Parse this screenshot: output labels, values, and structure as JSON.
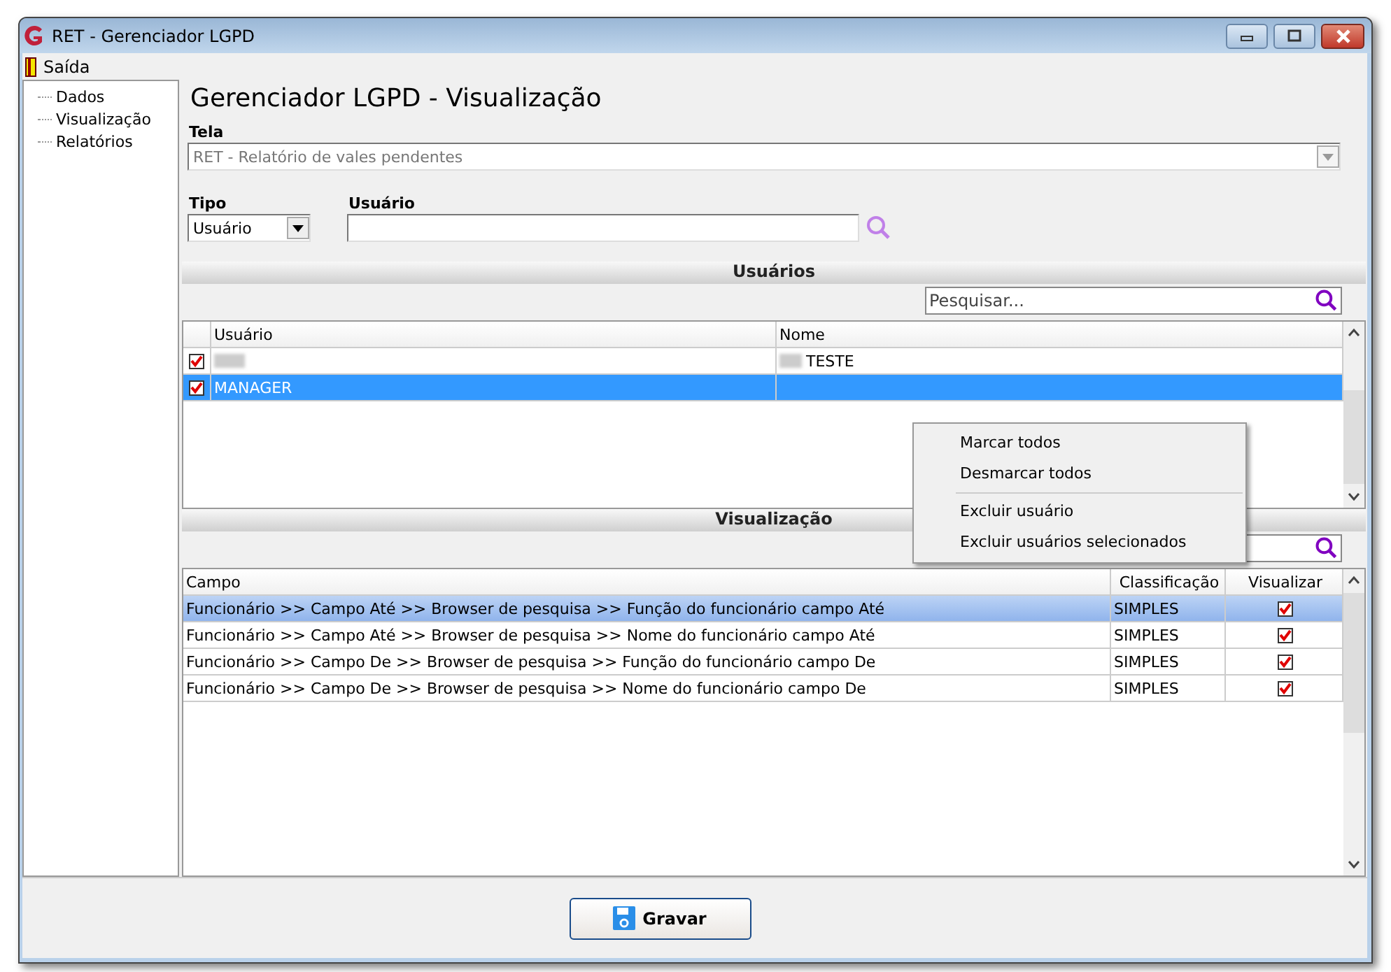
{
  "window": {
    "title": "RET - Gerenciador LGPD"
  },
  "menu": [
    {
      "label": "Saída"
    }
  ],
  "sidebar": {
    "items": [
      {
        "label": "Dados",
        "selected": false
      },
      {
        "label": "Visualização",
        "selected": false
      },
      {
        "label": "Relatórios",
        "selected": false
      }
    ]
  },
  "heading": "Gerenciador LGPD - Visualização",
  "tela": {
    "label": "Tela",
    "value": "RET - Relatório de vales pendentes",
    "disabled": true
  },
  "tipo": {
    "label": "Tipo",
    "value": "Usuário"
  },
  "usuario": {
    "label": "Usuário"
  },
  "usuarios": {
    "title": "Usuários",
    "search_placeholder": "Pesquisar...",
    "columns": [
      "Usuário",
      "Nome"
    ],
    "rows": [
      {
        "checked": true,
        "selected": false,
        "usuario": "",
        "usuario_blurred": true,
        "nome": "TESTE",
        "nome_blurred": true
      },
      {
        "checked": true,
        "selected": true,
        "usuario": "MANAGER",
        "usuario_blurred": false,
        "nome": "",
        "nome_blurred": false
      }
    ]
  },
  "context_menu": {
    "groups": [
      [
        "Marcar todos",
        "Desmarcar todos"
      ],
      [
        "Excluir usuário",
        "Excluir usuários selecionados"
      ]
    ]
  },
  "visualizacao": {
    "title": "Visualização",
    "columns": [
      "Campo",
      "Classificação",
      "Visualizar"
    ],
    "rows": [
      {
        "campo": "Funcionário >> Campo Até >> Browser de pesquisa >> Função do funcionário campo Até",
        "classificacao": "SIMPLES",
        "checked": true,
        "selected": true
      },
      {
        "campo": "Funcionário >> Campo Até >> Browser de pesquisa >> Nome do funcionário campo Até",
        "classificacao": "SIMPLES",
        "checked": true,
        "selected": false
      },
      {
        "campo": "Funcionário >> Campo De >> Browser de pesquisa >> Função do funcionário campo De",
        "classificacao": "SIMPLES",
        "checked": true,
        "selected": false
      },
      {
        "campo": "Funcionário >> Campo De >> Browser de pesquisa >> Nome do funcionário campo De",
        "classificacao": "SIMPLES",
        "checked": true,
        "selected": false
      }
    ]
  },
  "buttons": [
    {
      "label": "Gravar"
    }
  ]
}
